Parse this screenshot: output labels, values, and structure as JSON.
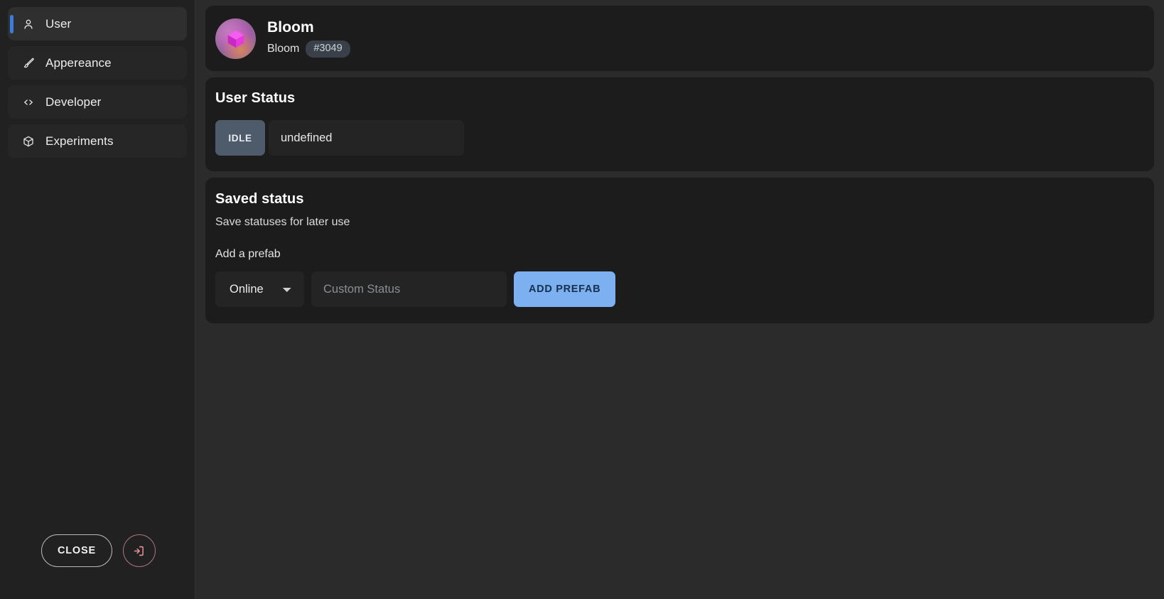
{
  "sidebar": {
    "items": [
      {
        "label": "User",
        "icon": "person-icon",
        "active": true
      },
      {
        "label": "Appereance",
        "icon": "paintbrush-icon",
        "active": false
      },
      {
        "label": "Developer",
        "icon": "code-brackets-icon",
        "active": false
      },
      {
        "label": "Experiments",
        "icon": "cube-icon",
        "active": false
      }
    ],
    "footer": {
      "close_label": "CLOSE",
      "logout_icon": "logout-icon"
    }
  },
  "profile": {
    "display_name": "Bloom",
    "username": "Bloom",
    "tag": "#3049",
    "avatar_icon": "cube-avatar-icon"
  },
  "user_status": {
    "title": "User Status",
    "chip_label": "IDLE",
    "value": "undefined"
  },
  "saved_status": {
    "title": "Saved status",
    "subtitle": "Save statuses for later use",
    "prefab_label": "Add a prefab",
    "select_value": "Online",
    "select_options": [
      "Online"
    ],
    "input_placeholder": "Custom Status",
    "input_value": "",
    "add_button_label": "ADD PREFAB"
  },
  "colors": {
    "page_bg": "#2b2b2b",
    "sidebar_bg": "#212121",
    "card_bg": "#1c1c1c",
    "accent_blue": "#3b7ddd",
    "button_blue": "#7db0f0",
    "status_chip": "#4d5b6b",
    "logout_red": "#e8919b"
  }
}
